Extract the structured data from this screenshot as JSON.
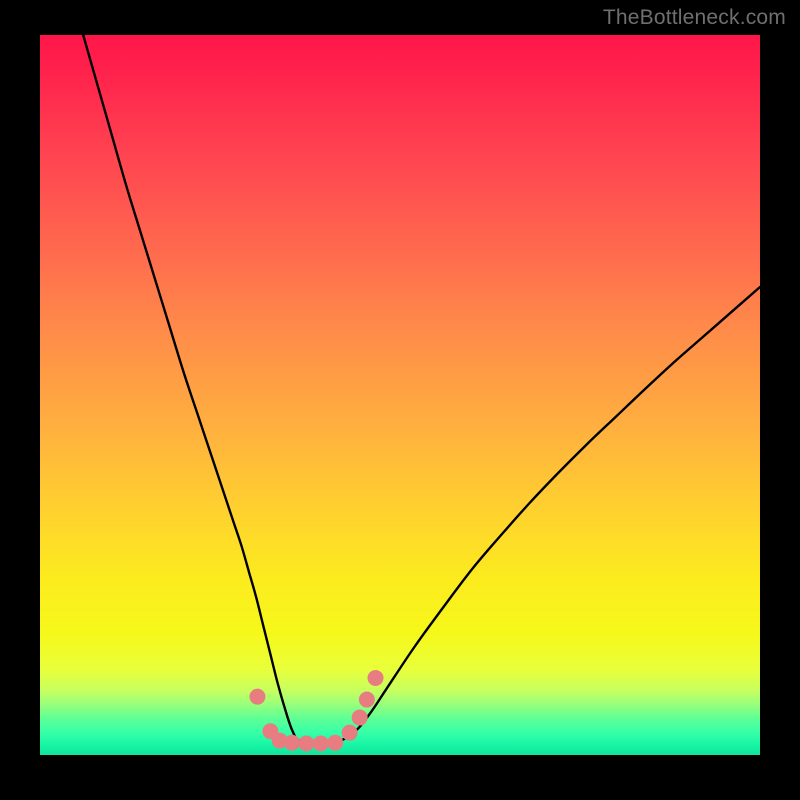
{
  "watermark": "TheBottleneck.com",
  "colors": {
    "background": "#000000",
    "curve": "#000000",
    "marker_fill": "#e87d81",
    "marker_stroke": "#e87d81",
    "gradient_top": "#ff1649",
    "gradient_bottom": "#0fe59b"
  },
  "chart_data": {
    "type": "line",
    "title": "",
    "xlabel": "",
    "ylabel": "",
    "xlim": [
      0,
      100
    ],
    "ylim": [
      0,
      100
    ],
    "grid": false,
    "legend": false,
    "series": [
      {
        "name": "bottleneck-curve",
        "x": [
          6,
          8,
          10,
          12,
          14,
          16,
          18,
          20,
          22,
          24,
          26,
          27,
          28,
          29,
          30,
          31,
          32,
          33,
          34,
          35,
          36,
          38,
          40,
          42,
          44,
          46,
          48,
          52,
          56,
          60,
          64,
          68,
          72,
          76,
          80,
          84,
          88,
          92,
          96,
          100
        ],
        "y": [
          100,
          93,
          86,
          79,
          72.5,
          66,
          59.5,
          53,
          47,
          41,
          35,
          32,
          29,
          25.5,
          22,
          18,
          14,
          10,
          6.5,
          3.5,
          2,
          1.6,
          1.6,
          2.1,
          3.5,
          6,
          9,
          15,
          20.5,
          25.8,
          30.5,
          35,
          39.2,
          43.2,
          47,
          50.8,
          54.5,
          58,
          61.5,
          65
        ]
      }
    ],
    "markers": [
      {
        "x": 30.2,
        "y": 8.1
      },
      {
        "x": 32.0,
        "y": 3.3
      },
      {
        "x": 33.3,
        "y": 2.0
      },
      {
        "x": 35.0,
        "y": 1.7
      },
      {
        "x": 37.0,
        "y": 1.6
      },
      {
        "x": 39.0,
        "y": 1.6
      },
      {
        "x": 41.0,
        "y": 1.7
      },
      {
        "x": 43.0,
        "y": 3.1
      },
      {
        "x": 44.4,
        "y": 5.2
      },
      {
        "x": 45.4,
        "y": 7.7
      },
      {
        "x": 46.6,
        "y": 10.7
      }
    ],
    "marker_radius": 7.5
  }
}
